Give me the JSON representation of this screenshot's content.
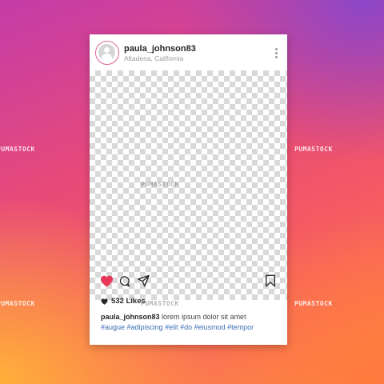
{
  "post": {
    "username": "paula_johnson83",
    "location": "Altadena, California",
    "likes": "532 Likes",
    "caption_user": "paula_johnson83",
    "caption_text": " lorem ipsum dolor sit amet",
    "caption_tags": "#augue  #adipiscing #elit #do #eiusmod #tempor"
  },
  "watermarks": {
    "text": "PUMASTOCK"
  },
  "icons": {
    "avatar": "default-user-avatar",
    "more": "vertical-ellipsis-icon",
    "like": "heart-icon",
    "comment": "speech-bubble-icon",
    "share": "paper-plane-icon",
    "save": "bookmark-icon",
    "likes_heart": "small-heart-icon"
  },
  "colors": {
    "like_active": "#e8385a",
    "avatar_ring": "#e0629a",
    "hashtag": "#3b6fb6"
  }
}
